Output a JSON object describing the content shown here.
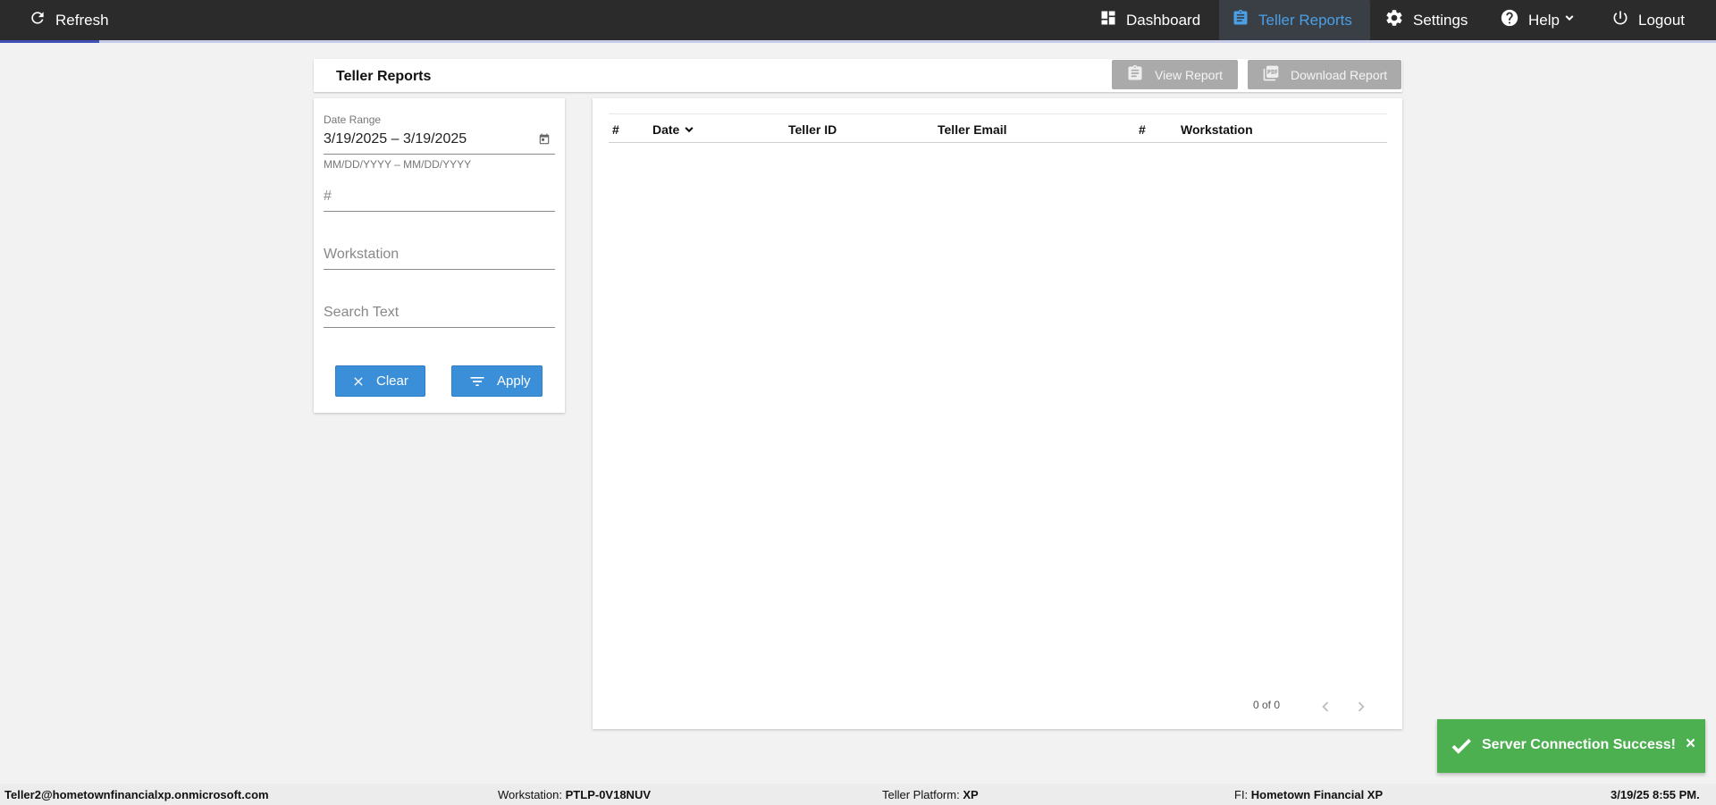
{
  "topbar": {
    "refresh_label": "Refresh",
    "nav": {
      "dashboard": "Dashboard",
      "teller_reports": "Teller Reports",
      "settings": "Settings",
      "help": "Help",
      "logout": "Logout"
    },
    "active_item": "Teller Reports",
    "active_color": "#4a9fe6"
  },
  "title_card": {
    "title": "Teller Reports",
    "view_report_label": "View Report",
    "download_report_label": "Download Report"
  },
  "filters": {
    "date_range_label": "Date Range",
    "date_range_value": "3/19/2025 – 3/19/2025",
    "date_format_hint": "MM/DD/YYYY – MM/DD/YYYY",
    "number_placeholder": "#",
    "workstation_placeholder": "Workstation",
    "search_placeholder": "Search Text",
    "clear_label": "Clear",
    "apply_label": "Apply",
    "button_color": "#3b8fd9"
  },
  "table": {
    "columns": [
      "#",
      "Date",
      "Teller ID",
      "Teller Email",
      "#",
      "Workstation"
    ],
    "sort_column": "Date",
    "rows": [],
    "pager_text": "0 of 0"
  },
  "toast": {
    "message": "Server Connection Success!",
    "close_label": "×",
    "color": "#4caf50"
  },
  "footer": {
    "user": "Teller2@hometownfinancialxp.onmicrosoft.com",
    "workstation_label": "Workstation:",
    "workstation_value": "PTLP-0V18NUV",
    "platform_label": "Teller Platform:",
    "platform_value": "XP",
    "fi_label": "FI:",
    "fi_value": "Hometown Financial XP",
    "datetime": "3/19/25 8:55 PM."
  }
}
